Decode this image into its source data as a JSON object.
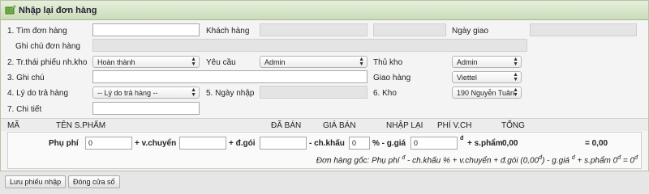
{
  "header": {
    "title": "Nhập lại đơn hàng"
  },
  "form": {
    "tim_don_hang": {
      "label": "1. Tìm đơn hàng",
      "value": ""
    },
    "khach_hang": {
      "label": "Khách hàng"
    },
    "ngay_giao": {
      "label": "Ngày giao"
    },
    "ghi_chu_don_hang": {
      "label": "Ghi chú đơn hàng"
    },
    "tr_thai": {
      "label": "2. Tr.thái phiếu nh.kho",
      "value": "Hoàn thành"
    },
    "yeu_cau": {
      "label": "Yêu cầu",
      "value": "Admin"
    },
    "thu_kho": {
      "label": "Thủ kho",
      "value": "Admin"
    },
    "ghi_chu": {
      "label": "3. Ghi chú",
      "value": ""
    },
    "giao_hang": {
      "label": "Giao hàng",
      "value": "Viettel"
    },
    "ly_do": {
      "label": "4. Lý do trả hàng",
      "value": "-- Lý do trả hàng --"
    },
    "ngay_nhap": {
      "label": "5. Ngày nhập"
    },
    "kho": {
      "label": "6. Kho",
      "value": "190 Nguyễn Tuân"
    },
    "chi_tiet": {
      "label": "7. Chi tiết",
      "value": ""
    }
  },
  "table": {
    "columns": [
      "MÃ",
      "TÊN S.PHẨM",
      "ĐÃ BÁN",
      "GIÁ BÁN",
      "NHẬP LẠI",
      "PHÍ V.CH",
      "TỔNG"
    ]
  },
  "fees": {
    "phu_phi_label": "Phụ phí",
    "phu_phi_value": "0",
    "v_chuyen_label": "+ v.chuyển",
    "d_goi_label": "+ đ.gói",
    "ch_khau_label": "- ch.khấu",
    "ch_khau_value": "0",
    "g_gia_label": "% - g.giá",
    "g_gia_value": "0",
    "currency": "đ",
    "s_pham_label": "+ s.phẩm",
    "s_pham_value": "0,00",
    "total": "= 0,00",
    "note_prefix": "Đơn hàng gốc: Phụ phí",
    "note_mid1": "- ch.khấu % + v.chuyển + đ.gói (0,00",
    "note_mid2": ") - g.giá",
    "note_mid3": "+ s.phẩm 0",
    "note_end": "= 0"
  },
  "buttons": {
    "save": "Lưu phiếu nhập",
    "close": "Đóng cửa sổ"
  }
}
